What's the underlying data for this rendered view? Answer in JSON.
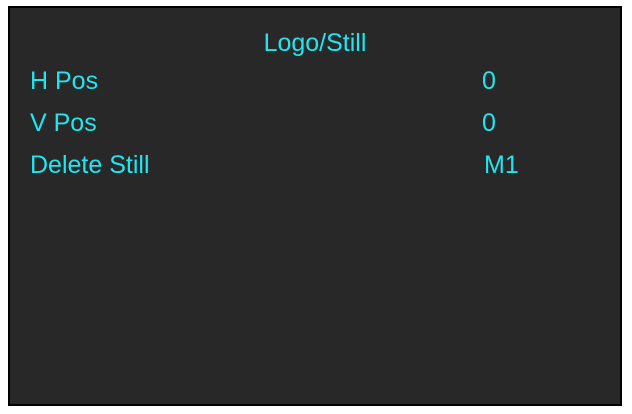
{
  "menu": {
    "title": "Logo/Still",
    "items": [
      {
        "label": "H Pos",
        "value": "0"
      },
      {
        "label": "V Pos",
        "value": "0"
      },
      {
        "label": "Delete Still",
        "value": "M1"
      }
    ]
  },
  "colors": {
    "text": "#22e5f0",
    "background": "#282828",
    "border": "#000000"
  }
}
